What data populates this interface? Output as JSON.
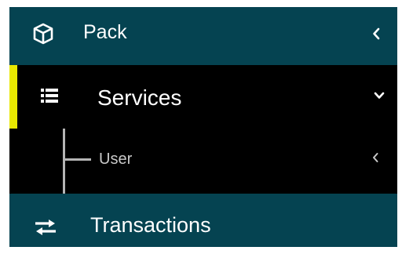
{
  "menu": {
    "pack": {
      "label": "Pack",
      "icon": "cube-icon",
      "chevron": "chevron-left-icon"
    },
    "services": {
      "label": "Services",
      "icon": "list-icon",
      "chevron": "chevron-down-icon",
      "accent_color": "#e8e800"
    },
    "user": {
      "label": "User",
      "chevron": "chevron-left-icon"
    },
    "transactions": {
      "label": "Transactions",
      "icon": "exchange-icon"
    }
  },
  "colors": {
    "teal": "#054351",
    "active_bg": "#000000",
    "text": "#ffffff",
    "subtext": "#c9c9c9"
  }
}
